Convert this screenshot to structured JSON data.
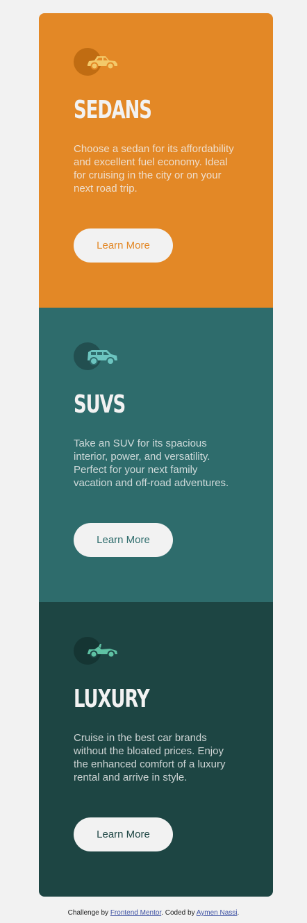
{
  "colors": {
    "page_bg": "#f2f2f2",
    "sedans_bg": "#e38826",
    "suvs_bg": "#2e6c6c",
    "luxury_bg": "#1d4543",
    "text_light": "#f2f2f2",
    "link": "#3e52a3"
  },
  "cards": [
    {
      "icon": "sedan-car-icon",
      "title": "SEDANS",
      "text": "Choose a sedan for its affordability and excellent fuel economy. Ideal for cruising in the city or on your next road trip.",
      "button_label": "Learn More"
    },
    {
      "icon": "suv-car-icon",
      "title": "SUVS",
      "text": "Take an SUV for its spacious interior, power, and versatility. Perfect for your next family vacation and off-road adventures.",
      "button_label": "Learn More"
    },
    {
      "icon": "luxury-car-icon",
      "title": "LUXURY",
      "text": "Cruise in the best car brands without the bloated prices. Enjoy the enhanced comfort of a luxury rental and arrive in style.",
      "button_label": "Learn More"
    }
  ],
  "footer": {
    "prefix": "Challenge by ",
    "challenge_link": "Frontend Mentor",
    "middle": ". Coded by ",
    "author_link": "Aymen Nassi",
    "suffix": "."
  }
}
